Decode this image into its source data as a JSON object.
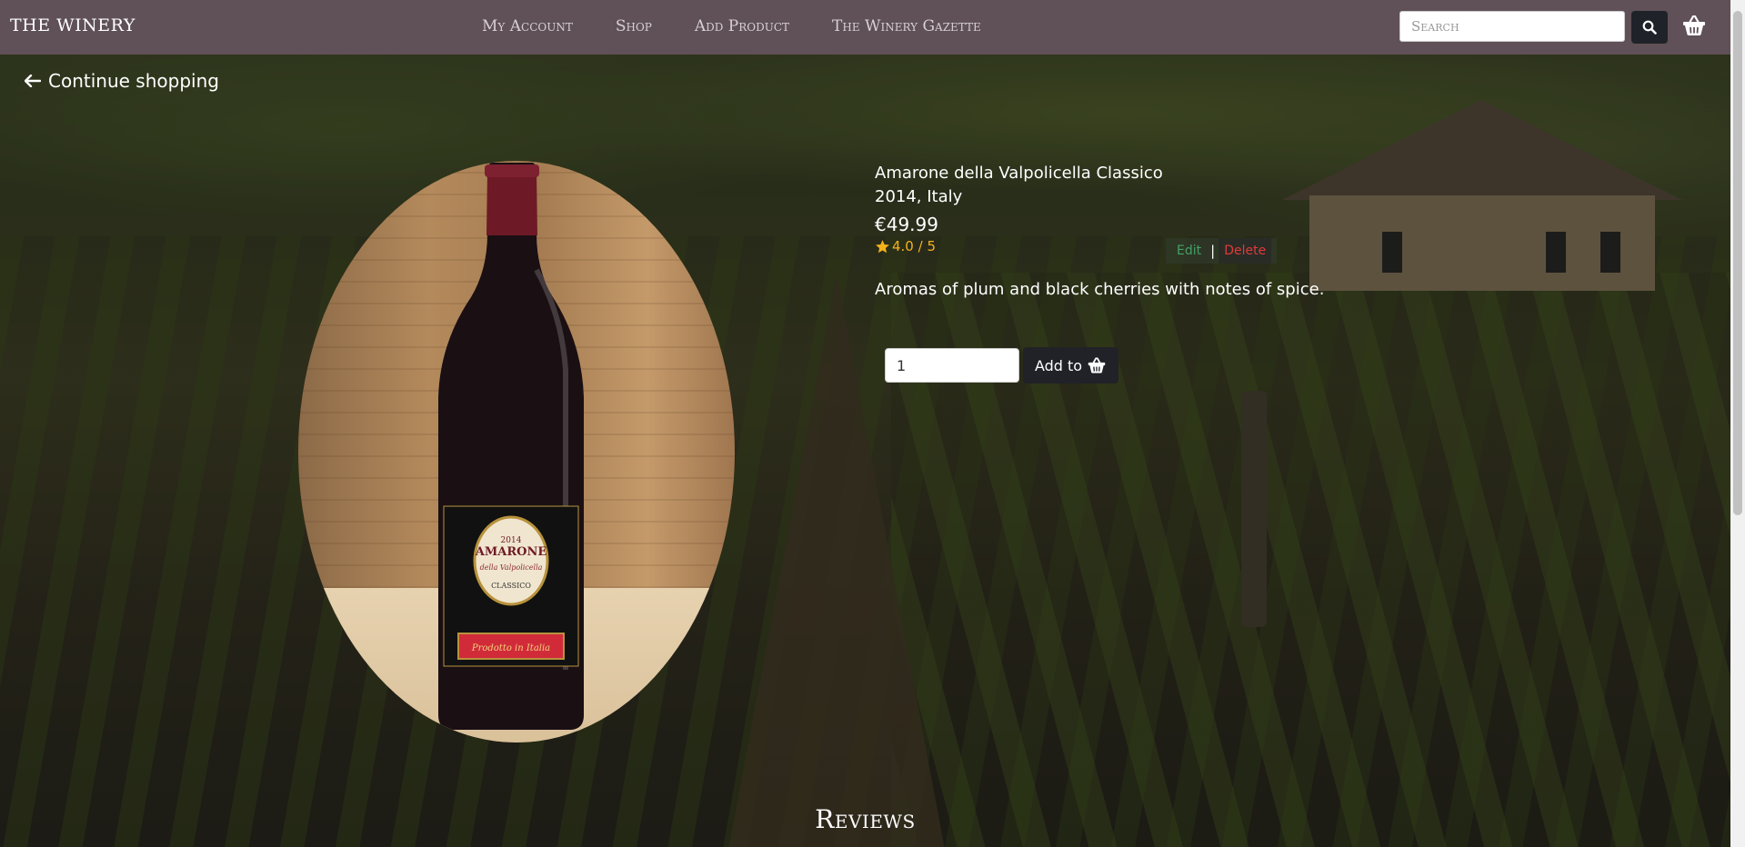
{
  "navbar": {
    "brand": "The Winery",
    "links": [
      "My Account",
      "Shop",
      "Add Product",
      "The Winery Gazette"
    ],
    "search_placeholder": "Search",
    "search_icon": "search-icon",
    "basket_icon": "basket-icon"
  },
  "page": {
    "continue_label": "Continue shopping",
    "back_icon": "arrow-left-icon"
  },
  "product": {
    "name": "Amarone della Valpolicella Classico",
    "vintage_origin": "2014, Italy",
    "price": "€49.99",
    "rating": "4.0 / 5",
    "rating_icon": "star-icon",
    "description": "Aromas of plum and black cherries with notes of spice.",
    "quantity": "1",
    "add_label": "Add to",
    "admin": {
      "edit": "Edit",
      "separator": "|",
      "delete": "Delete"
    },
    "label_text": {
      "year": "2014",
      "brand": "AMARONE",
      "sub": "della Valpolicella",
      "classico": "CLASSICO",
      "footer": "Prodotto in Italia"
    }
  },
  "reviews": {
    "title": "Reviews"
  },
  "colors": {
    "navbar": "#5f5157",
    "button_dark": "#202227",
    "rating": "#f5b21b",
    "edit": "#43a066",
    "delete": "#e03a3a"
  }
}
